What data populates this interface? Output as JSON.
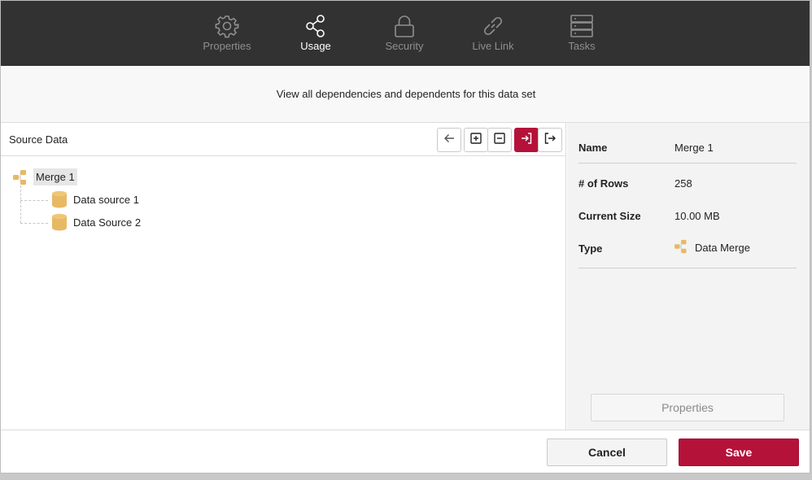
{
  "tabs": [
    {
      "label": "Properties",
      "icon": "gear-icon",
      "active": false
    },
    {
      "label": "Usage",
      "icon": "share-icon",
      "active": true
    },
    {
      "label": "Security",
      "icon": "lock-icon",
      "active": false
    },
    {
      "label": "Live Link",
      "icon": "link-icon",
      "active": false
    },
    {
      "label": "Tasks",
      "icon": "server-icon",
      "active": false
    }
  ],
  "subtitle": "View all dependencies and dependents for this data set",
  "panel": {
    "title": "Source Data",
    "toolbar": [
      "back-arrow-icon",
      "expand-all-icon",
      "collapse-all-icon",
      "dependencies-icon",
      "dependents-icon"
    ]
  },
  "tree": {
    "root": {
      "label": "Merge 1",
      "icon": "merge-icon"
    },
    "children": [
      {
        "label": "Data source 1",
        "icon": "database-icon"
      },
      {
        "label": "Data Source 2",
        "icon": "database-icon"
      }
    ]
  },
  "details": {
    "name_label": "Name",
    "name_value": "Merge 1",
    "rows_label": "# of Rows",
    "rows_value": "258",
    "size_label": "Current Size",
    "size_value": "10.00 MB",
    "type_label": "Type",
    "type_value": "Data Merge",
    "properties_button": "Properties"
  },
  "footer": {
    "cancel": "Cancel",
    "save": "Save"
  },
  "colors": {
    "accent": "#b5123a",
    "topbar": "#333232",
    "db_icon": "#e8b964"
  }
}
